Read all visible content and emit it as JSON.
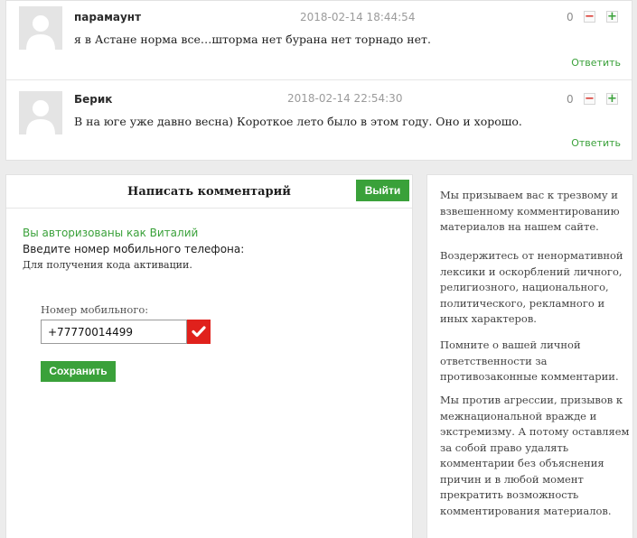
{
  "comments": [
    {
      "author": "парамаунт",
      "date": "2018-02-14 18:44:54",
      "score": "0",
      "minus_icon": "minus-icon",
      "plus_icon": "plus-icon",
      "text": "я в Астане норма все…шторма нет бурана нет торнадо нет.",
      "reply_label": "Ответить"
    },
    {
      "author": "Берик",
      "date": "2018-02-14 22:54:30",
      "score": "0",
      "minus_icon": "minus-icon",
      "plus_icon": "plus-icon",
      "text": "В на юге уже давно весна) Короткое лето было в этом году. Оно и хорошо.",
      "reply_label": "Ответить"
    }
  ],
  "write_form": {
    "title": "Написать комментарий",
    "logout_label": "Выйти",
    "authorized_as": "Вы авторизованы как Виталий",
    "enter_phone": "Введите номер мобильного телефона:",
    "for_code": "Для получения кода активации.",
    "phone_label": "Номер мобильного:",
    "phone_value": "+77770014499",
    "save_label": "Сохранить"
  },
  "rules": [
    "Мы призываем вас к трезвому и взвешенному комментированию материалов на нашем сайте.",
    "Воздержитесь от ненормативной лексики и оскорблений личного, религиозного, национального, политического, рекламного и иных характеров.",
    "Помните о вашей личной ответственности за противозаконные комментарии.",
    "Мы против агрессии, призывов к межнациональной вражде и экстремизму. А потому оставляем за собой право удалять комментарии без объяснения причин и в любой момент прекратить возможность комментирования материалов."
  ],
  "colors": {
    "accent_green": "#3aa13a",
    "accent_red": "#e0211c",
    "page_bg": "#ececec"
  }
}
